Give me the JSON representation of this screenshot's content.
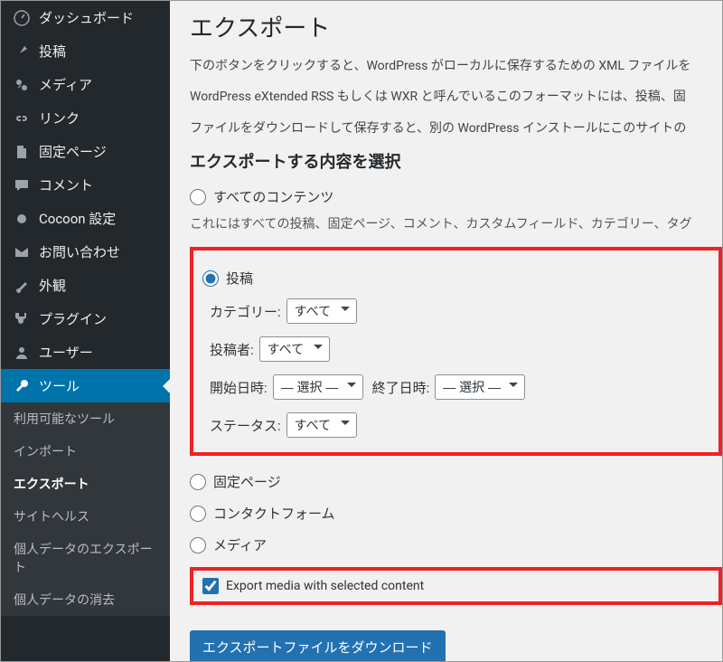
{
  "sidebar": {
    "items": [
      {
        "label": "ダッシュボード"
      },
      {
        "label": "投稿"
      },
      {
        "label": "メディア"
      },
      {
        "label": "リンク"
      },
      {
        "label": "固定ページ"
      },
      {
        "label": "コメント"
      },
      {
        "label": "Cocoon 設定"
      },
      {
        "label": "お問い合わせ"
      },
      {
        "label": "外観"
      },
      {
        "label": "プラグイン"
      },
      {
        "label": "ユーザー"
      },
      {
        "label": "ツール"
      }
    ],
    "sub": [
      {
        "label": "利用可能なツール"
      },
      {
        "label": "インポート"
      },
      {
        "label": "エクスポート"
      },
      {
        "label": "サイトヘルス"
      },
      {
        "label": "個人データのエクスポート"
      },
      {
        "label": "個人データの消去"
      }
    ]
  },
  "main": {
    "title": "エクスポート",
    "intro1": "下のボタンをクリックすると、WordPress がローカルに保存するための XML ファイルを",
    "intro2": "WordPress eXtended RSS もしくは WXR と呼んでいるこのフォーマットには、投稿、固",
    "intro3": "ファイルをダウンロードして保存すると、別の WordPress インストールにこのサイトの",
    "section_title": "エクスポートする内容を選択",
    "radio_all": "すべてのコンテンツ",
    "all_desc": "これにはすべての投稿、固定ページ、コメント、カスタムフィールド、カテゴリー、タグ",
    "radio_posts": "投稿",
    "field_cat": "カテゴリー:",
    "field_author": "投稿者:",
    "field_start": "開始日時:",
    "field_end": "終了日時:",
    "field_status": "ステータス:",
    "opt_all": "すべて",
    "opt_select": "— 選択 —",
    "radio_pages": "固定ページ",
    "radio_contactform": "コンタクトフォーム",
    "radio_media": "メディア",
    "cb_export_media": "Export media with selected content",
    "btn_download": "エクスポートファイルをダウンロード"
  }
}
